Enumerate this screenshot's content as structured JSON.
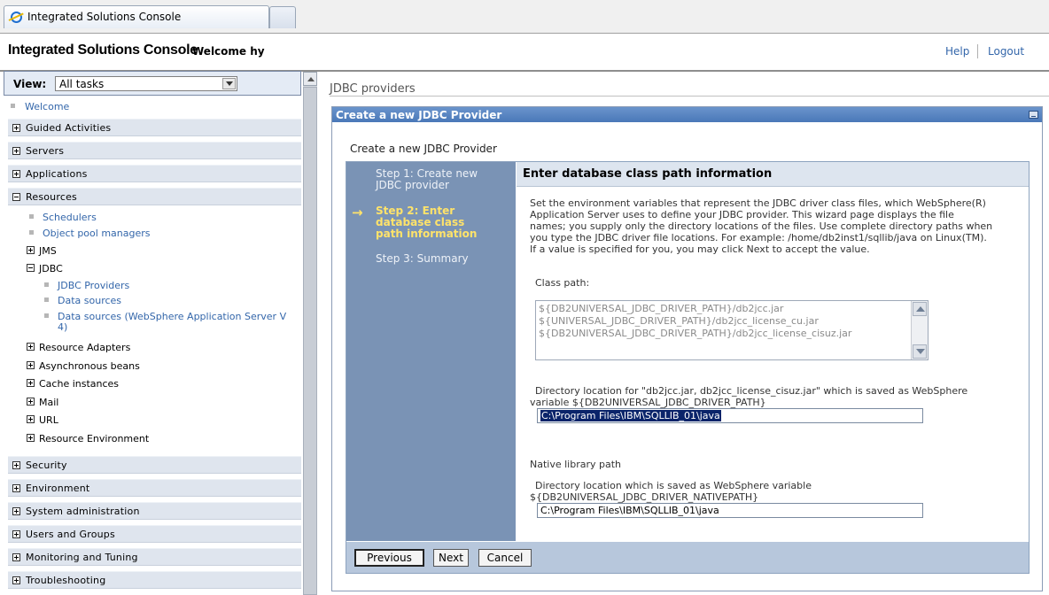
{
  "browser": {
    "tab_title": "Integrated Solutions Console"
  },
  "header": {
    "brand": "Integrated Solutions Console",
    "welcome": "Welcome hy",
    "help": "Help",
    "logout": "Logout"
  },
  "nav": {
    "view_label": "View:",
    "view_value": "All tasks",
    "welcome": "Welcome",
    "categories": {
      "guided": "Guided Activities",
      "servers": "Servers",
      "applications": "Applications",
      "resources": "Resources",
      "security": "Security",
      "environment": "Environment",
      "sysadmin": "System administration",
      "users": "Users and Groups",
      "monitoring": "Monitoring and Tuning",
      "troubleshooting": "Troubleshooting"
    },
    "resources": {
      "schedulers": "Schedulers",
      "object_pool": "Object pool managers",
      "jms": "JMS",
      "jdbc": "JDBC",
      "jdbc_providers": "JDBC Providers",
      "data_sources": "Data sources",
      "data_sources_v4_line1": "Data sources (WebSphere Application Server V",
      "data_sources_v4_line2": "4)",
      "resource_adapters": "Resource Adapters",
      "async_beans": "Asynchronous beans",
      "cache": "Cache instances",
      "mail": "Mail",
      "url": "URL",
      "resource_env": "Resource Environment"
    }
  },
  "main": {
    "breadcrumb": "JDBC providers",
    "panel_title": "Create a new JDBC Provider",
    "subtitle": "Create a new JDBC Provider",
    "steps": {
      "s1_l1": "Step 1: Create new",
      "s1_l2": "JDBC provider",
      "s2_l1": "Step 2: Enter",
      "s2_l2": "database class",
      "s2_l3": "path information",
      "s3": "Step 3: Summary"
    },
    "content_title": "Enter database class path information",
    "desc": {
      "l1": "Set the environment variables that represent the JDBC driver class files, which WebSphere(R)",
      "l2": "Application Server uses to define your JDBC provider. This wizard page displays the file",
      "l3": "names; you supply only the directory locations of the files. Use complete directory paths when",
      "l4": "you type the JDBC driver file locations. For example: /home/db2inst1/sqllib/java on Linux(TM).",
      "l5": "If a value is specified for you, you may click Next to accept the value."
    },
    "class_path_label": "Class path:",
    "class_path_lines": {
      "l1": "${DB2UNIVERSAL_JDBC_DRIVER_PATH}/db2jcc.jar",
      "l2": "${UNIVERSAL_JDBC_DRIVER_PATH}/db2jcc_license_cu.jar",
      "l3": "${DB2UNIVERSAL_JDBC_DRIVER_PATH}/db2jcc_license_cisuz.jar"
    },
    "dir1_label_l1": "Directory location for \"db2jcc.jar, db2jcc_license_cisuz.jar\" which is saved as WebSphere",
    "dir1_label_l2": "variable ${DB2UNIVERSAL_JDBC_DRIVER_PATH}",
    "dir1_value": "C:\\Program Files\\IBM\\SQLLIB_01\\java",
    "native_label": "Native library path",
    "dir2_label_l1": "Directory location which is saved as WebSphere variable",
    "dir2_label_l2": "${DB2UNIVERSAL_JDBC_DRIVER_NATIVEPATH}",
    "dir2_value": "C:\\Program Files\\IBM\\SQLLIB_01\\java",
    "buttons": {
      "previous": "Previous",
      "next": "Next",
      "cancel": "Cancel"
    }
  }
}
